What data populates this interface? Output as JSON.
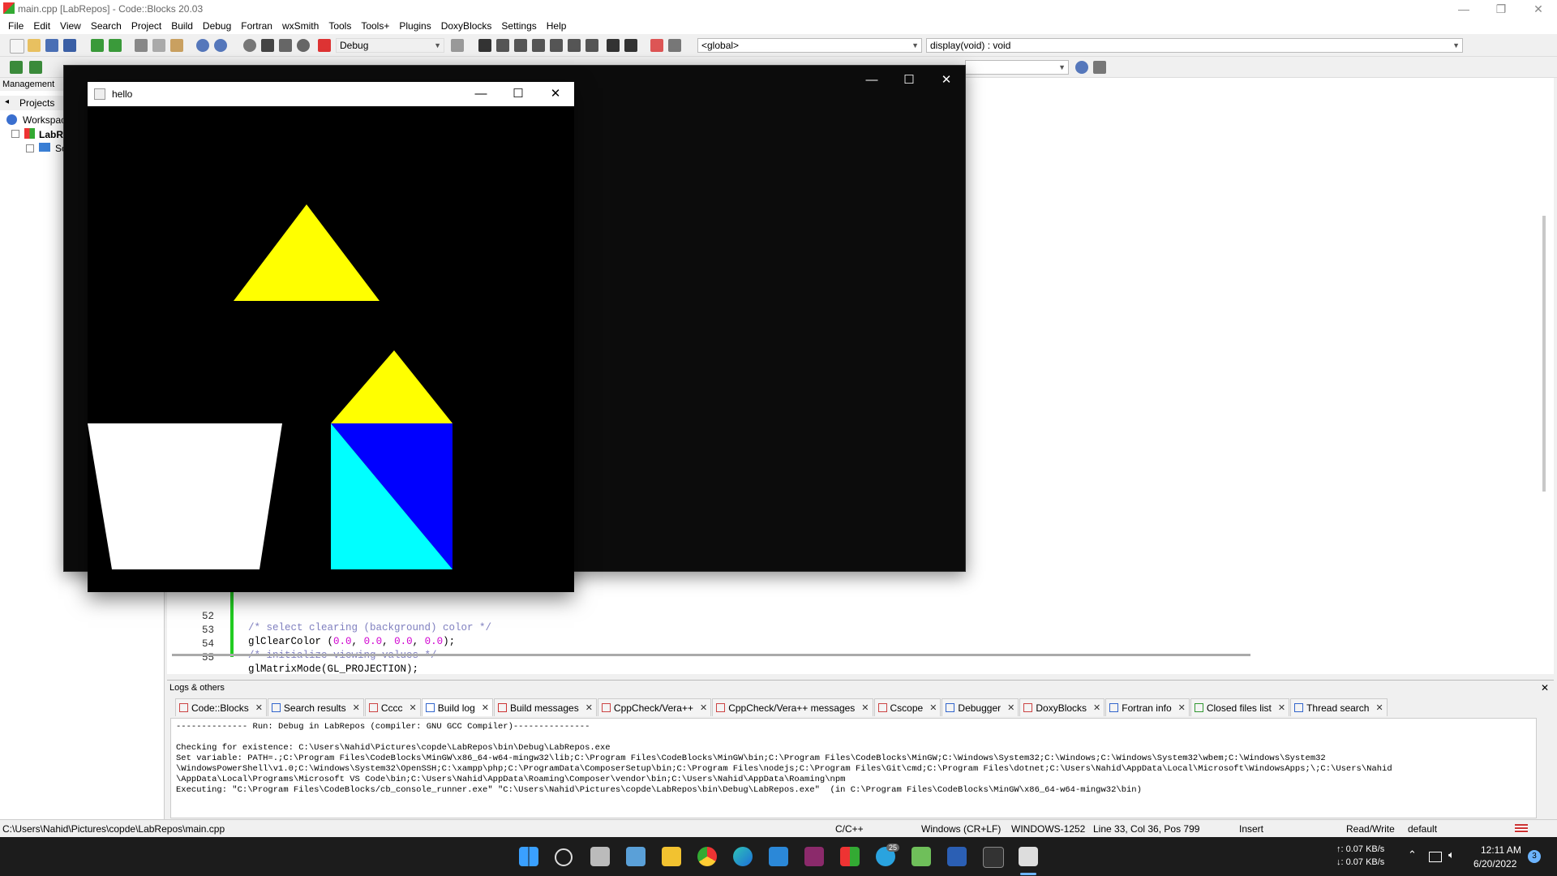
{
  "app": {
    "title": "main.cpp [LabRepos] - Code::Blocks 20.03",
    "window_controls": [
      "—",
      "❐",
      "✕"
    ]
  },
  "menu": [
    "File",
    "Edit",
    "View",
    "Search",
    "Project",
    "Build",
    "Debug",
    "Fortran",
    "wxSmith",
    "Tools",
    "Tools+",
    "Plugins",
    "DoxyBlocks",
    "Settings",
    "Help"
  ],
  "toolbar": {
    "build_target": "Debug",
    "scope": "<global>",
    "function": "display(void) : void"
  },
  "management": {
    "title": "Management",
    "tab": "Projects",
    "tree": [
      {
        "label": "Workspace"
      },
      {
        "label": "LabRe"
      },
      {
        "label": "So"
      }
    ]
  },
  "editor": {
    "lines": [
      {
        "num": "52",
        "code": "/* select clearing (background) color */",
        "kind": "comment"
      },
      {
        "num": "53",
        "code": "glClearColor (0.0, 0.0, 0.0, 0.0);",
        "kind": "code"
      },
      {
        "num": "54",
        "code": "/* initialize viewing values */",
        "kind": "comment"
      },
      {
        "num": "55",
        "code": "glMatrixMode(GL_PROJECTION);",
        "kind": "code"
      }
    ]
  },
  "logs": {
    "title": "Logs & others",
    "tabs": [
      {
        "label": "Code::Blocks",
        "color": "#cc4444"
      },
      {
        "label": "Search results",
        "color": "#3366cc"
      },
      {
        "label": "Cccc",
        "color": "#cc4444"
      },
      {
        "label": "Build log",
        "color": "#3366cc"
      },
      {
        "label": "Build messages",
        "color": "#cc3333"
      },
      {
        "label": "CppCheck/Vera++",
        "color": "#cc4444"
      },
      {
        "label": "CppCheck/Vera++ messages",
        "color": "#cc4444"
      },
      {
        "label": "Cscope",
        "color": "#cc4444"
      },
      {
        "label": "Debugger",
        "color": "#3366cc"
      },
      {
        "label": "DoxyBlocks",
        "color": "#cc4444"
      },
      {
        "label": "Fortran info",
        "color": "#3366cc"
      },
      {
        "label": "Closed files list",
        "color": "#339933"
      },
      {
        "label": "Thread search",
        "color": "#3366cc"
      }
    ],
    "active_tab": 3,
    "text": "-------------- Run: Debug in LabRepos (compiler: GNU GCC Compiler)---------------\n\nChecking for existence: C:\\Users\\Nahid\\Pictures\\copde\\LabRepos\\bin\\Debug\\LabRepos.exe\nSet variable: PATH=.;C:\\Program Files\\CodeBlocks\\MinGW\\x86_64-w64-mingw32\\lib;C:\\Program Files\\CodeBlocks\\MinGW\\bin;C:\\Program Files\\CodeBlocks\\MinGW;C:\\Windows\\System32;C:\\Windows;C:\\Windows\\System32\\wbem;C:\\Windows\\System32\n\\WindowsPowerShell\\v1.0;C:\\Windows\\System32\\OpenSSH;C:\\xampp\\php;C:\\ProgramData\\ComposerSetup\\bin;C:\\Program Files\\nodejs;C:\\Program Files\\Git\\cmd;C:\\Program Files\\dotnet;C:\\Users\\Nahid\\AppData\\Local\\Microsoft\\WindowsApps;\\;C:\\Users\\Nahid\n\\AppData\\Local\\Programs\\Microsoft VS Code\\bin;C:\\Users\\Nahid\\AppData\\Roaming\\Composer\\vendor\\bin;C:\\Users\\Nahid\\AppData\\Roaming\\npm\nExecuting: \"C:\\Program Files\\CodeBlocks/cb_console_runner.exe\" \"C:\\Users\\Nahid\\Pictures\\copde\\LabRepos\\bin\\Debug\\LabRepos.exe\"  (in C:\\Program Files\\CodeBlocks\\MinGW\\x86_64-w64-mingw32\\bin)"
  },
  "status": {
    "path": "C:\\Users\\Nahid\\Pictures\\copde\\LabRepos\\main.cpp",
    "language": "C/C++",
    "line_endings": "Windows (CR+LF)",
    "encoding": "WINDOWS-1252",
    "position": "Line 33, Col 36, Pos 799",
    "mode": "Insert",
    "access": "Read/Write",
    "profile": "default"
  },
  "hello_window": {
    "title": "hello",
    "controls": [
      "—",
      "☐",
      "✕"
    ],
    "colors": {
      "background": "#000000",
      "triangle": "#ffff00",
      "roof": "#ffff00",
      "wall_upper": "#0000ff",
      "wall_lower": "#00ffff",
      "bucket": "#ffffff"
    }
  },
  "console_window": {
    "controls": [
      "—",
      "☐",
      "✕"
    ]
  },
  "taskbar": {
    "net_up": "↑: 0.07 KB/s",
    "net_down": "↓: 0.07 KB/s",
    "time": "12:11 AM",
    "date": "6/20/2022",
    "telegram_badge": "25",
    "notification_count": "3"
  }
}
